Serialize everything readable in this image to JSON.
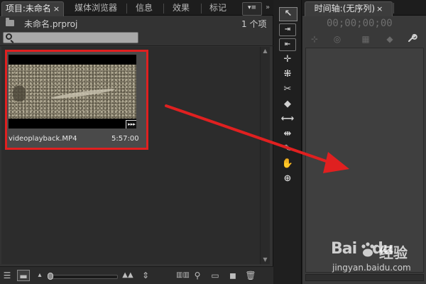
{
  "project_panel": {
    "tabs": [
      {
        "label": "项目:未命名",
        "active": true,
        "closable": true
      },
      {
        "label": "媒体浏览器",
        "active": false
      },
      {
        "label": "信息",
        "active": false
      },
      {
        "label": "效果",
        "active": false
      },
      {
        "label": "标记",
        "active": false
      }
    ],
    "menu_icon": "▾≡",
    "scroll_icon": "»",
    "project_file": "未命名.prproj",
    "item_count": "1 个项",
    "search": {
      "value": "",
      "placeholder": ""
    },
    "clip": {
      "name": "videoplayback.MP4",
      "duration": "5:57:00",
      "badge": "av-badge-icon",
      "selected_highlight": "#e02020"
    },
    "bottom_toolbar": {
      "list_view": "list-view-icon",
      "icon_view": "icon-view-icon",
      "zoom_out": "mountain-small-icon",
      "zoom_in": "mountain-large-icon",
      "sort": "sort-icon",
      "automate": "automate-to-sequence-icon",
      "find": "find-icon",
      "new_bin": "new-bin-icon",
      "new_item": "new-item-icon",
      "clear": "trash-icon",
      "zoom_level": 0.0
    }
  },
  "tools_panel": {
    "tools": [
      {
        "name": "selection-tool-icon",
        "glyph": "↖",
        "selected": true
      },
      {
        "name": "track-select-tool-icon",
        "glyph": "⇥"
      },
      {
        "name": "ripple-edit-tool-icon",
        "glyph": "⇤"
      },
      {
        "name": "rolling-edit-tool-icon",
        "glyph": "✛"
      },
      {
        "name": "rate-stretch-tool-icon",
        "glyph": "⁜"
      },
      {
        "name": "razor-tool-icon",
        "glyph": "✂"
      },
      {
        "name": "slip-tool-icon",
        "glyph": "◆"
      },
      {
        "name": "slide-tool-icon",
        "glyph": "⟷"
      },
      {
        "name": "pen-tool-icon",
        "glyph": "⇹"
      },
      {
        "name": "pen-nib-tool-icon",
        "glyph": "✎"
      },
      {
        "name": "hand-tool-icon",
        "glyph": "✋"
      },
      {
        "name": "zoom-tool-icon",
        "glyph": "⊕"
      }
    ]
  },
  "timeline_panel": {
    "tab_label": "时间轴:(无序列)",
    "close": "×",
    "timecode": "00;00;00;00",
    "toolbar": [
      {
        "name": "snap-icon",
        "glyph": "⊹"
      },
      {
        "name": "link-icon",
        "glyph": "◎"
      },
      {
        "name": "add-marker-icon",
        "glyph": "▦"
      },
      {
        "name": "marker-icon",
        "glyph": "◆"
      },
      {
        "name": "wrench-icon",
        "glyph": "🔧"
      }
    ]
  },
  "annotation": {
    "arrow_color": "#e02020"
  },
  "watermark": {
    "logo_text": "Bai",
    "logo_text_2": "du",
    "chinese": "经验",
    "url": "jingyan.baidu.com"
  }
}
